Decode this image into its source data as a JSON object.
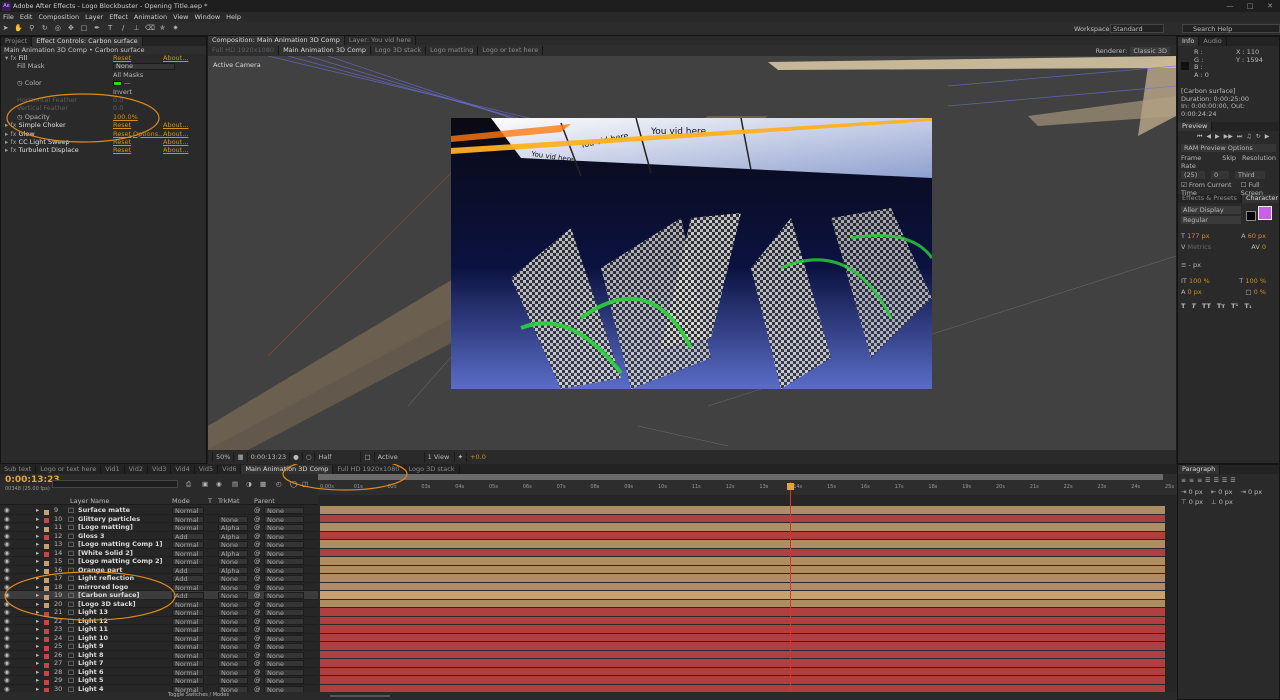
{
  "window": {
    "title": "Adobe After Effects - Logo Blockbuster - Opening Title.aep *",
    "logo": "Ae"
  },
  "menu": [
    "File",
    "Edit",
    "Composition",
    "Layer",
    "Effect",
    "Animation",
    "View",
    "Window",
    "Help"
  ],
  "toolbar": {
    "tools": [
      "selection-icon",
      "hand-icon",
      "zoom-icon",
      "rotate-icon",
      "camera-orbit-icon",
      "pan-behind-icon",
      "rectangle-icon",
      "pen-icon",
      "text-icon",
      "brush-icon",
      "clone-stamp-icon",
      "eraser-icon",
      "roto-brush-icon",
      "puppet-pin-icon"
    ],
    "workspace_label": "Workspace:",
    "workspace_value": "Standard",
    "search_placeholder": "Search Help"
  },
  "left_panel": {
    "tabs": [
      "Project",
      "Effect Controls: Carbon surface"
    ],
    "breadcrumb": "Main Animation 3D Comp • Carbon surface",
    "effects": [
      {
        "name": "Fill",
        "reset": "Reset",
        "about": "About..."
      },
      {
        "name": "Fill Mask",
        "value": "None"
      },
      {
        "name": "",
        "value": "All Masks"
      },
      {
        "name": "Color"
      },
      {
        "name": "",
        "value": "Invert"
      },
      {
        "name": "Horizontal Feather",
        "value": "0.0"
      },
      {
        "name": "Vertical Feather",
        "value": "0.0"
      },
      {
        "name": "Opacity",
        "value": "100.0%"
      },
      {
        "name": "Simple Choker",
        "reset": "Reset",
        "about": "About..."
      },
      {
        "name": "Glow",
        "reset": "Reset",
        "options": "Options...",
        "about": "About..."
      },
      {
        "name": "CC Light Sweep",
        "reset": "Reset",
        "about": "About..."
      },
      {
        "name": "Turbulent Displace",
        "reset": "Reset",
        "about": "About..."
      }
    ]
  },
  "composition": {
    "tabs": [
      "Composition: Main Animation 3D Comp",
      "Layer: You vid here"
    ],
    "subtabs": [
      "Full HD 1920x1080",
      "Main Animation 3D Comp",
      "Logo 3D stack",
      "Logo matting",
      "Logo or text here"
    ],
    "renderer": "Renderer:",
    "renderer_value": "Classic 3D",
    "view_label": "Active Camera",
    "frame_text": "You vid here",
    "viewbar": [
      "50%",
      "0:00:13:23",
      "Half",
      "Active Camera",
      "1 View",
      "+0.0"
    ]
  },
  "info": {
    "tabs": [
      "Info",
      "Audio"
    ],
    "r": "R :",
    "g": "G :",
    "b": "B :",
    "a": "A : 0",
    "x": "X : 110",
    "y": "Y : 1594",
    "layer": "[Carbon surface]",
    "duration": "Duration: 0:00:25:00",
    "inout": "In: 0:00:00:00, Out: 0:00:24:24"
  },
  "preview": {
    "title": "Preview",
    "options": "RAM Preview Options",
    "frame_rate": "Frame Rate",
    "skip": "Skip",
    "resolution": "Resolution",
    "fps": "(25)",
    "skip_val": "0",
    "res_val": "Third",
    "from_current": "From Current Time",
    "full_screen": "Full Screen"
  },
  "character": {
    "tabs": [
      "Effects & Presets",
      "Character"
    ],
    "font": "Aller Display",
    "style": "Regular",
    "size": "177 px",
    "leading": "60 px",
    "kern": "Metrics",
    "track": "0",
    "unit": "- px",
    "vscale": "100 %",
    "hscale": "100 %",
    "baseline": "0 px",
    "tsume": "0 %",
    "fill_color": "#c85fe6"
  },
  "timeline": {
    "tabs": [
      "Sub text",
      "Logo or text here",
      "Vid1",
      "Vid2",
      "Vid3",
      "Vid4",
      "Vid5",
      "Vid6",
      "Main Animation 3D Comp",
      "Full HD 1920x1080",
      "Logo 3D stack"
    ],
    "timecode": "0:00:13:23",
    "frames": "00348 (25.00 fps)",
    "columns": {
      "name": "Layer Name",
      "mode": "Mode",
      "t": "T",
      "trkmat": "TrkMat",
      "parent": "Parent"
    },
    "toggle": "Toggle Switches / Modes",
    "ruler": [
      "0:00s",
      "01s",
      "02s",
      "03s",
      "04s",
      "05s",
      "06s",
      "07s",
      "08s",
      "09s",
      "10s",
      "11s",
      "12s",
      "13s",
      "14s",
      "15s",
      "16s",
      "17s",
      "18s",
      "19s",
      "20s",
      "21s",
      "22s",
      "23s",
      "24s",
      "25s"
    ],
    "layers": [
      {
        "num": "9",
        "name": "Surface matte",
        "mode": "Normal",
        "trk": "",
        "parent": "None",
        "color": "#c6a06e"
      },
      {
        "num": "10",
        "name": "Glittery particles",
        "mode": "Normal",
        "trk": "None",
        "parent": "None",
        "color": "#c94444"
      },
      {
        "num": "11",
        "name": "[Logo matting]",
        "mode": "Normal",
        "trk": "Alpha",
        "parent": "None",
        "color": "#c6a06e"
      },
      {
        "num": "12",
        "name": "Gloss 3",
        "mode": "Add",
        "trk": "Alpha",
        "parent": "None",
        "color": "#c94444"
      },
      {
        "num": "13",
        "name": "[Logo matting Comp 1]",
        "mode": "Normal",
        "trk": "None",
        "parent": "None",
        "color": "#c6a06e"
      },
      {
        "num": "14",
        "name": "[White Solid 2]",
        "mode": "Normal",
        "trk": "Alpha",
        "parent": "None",
        "color": "#c94444"
      },
      {
        "num": "15",
        "name": "[Logo matting Comp 2]",
        "mode": "Normal",
        "trk": "None",
        "parent": "None",
        "color": "#c6a06e"
      },
      {
        "num": "16",
        "name": "Orange part",
        "mode": "Add",
        "trk": "Alpha",
        "parent": "None",
        "color": "#c6a06e"
      },
      {
        "num": "17",
        "name": "Light reflection",
        "mode": "Add",
        "trk": "None",
        "parent": "None",
        "color": "#c6a06e"
      },
      {
        "num": "18",
        "name": "mirrored logo",
        "mode": "Normal",
        "trk": "None",
        "parent": "None",
        "color": "#c6a06e"
      },
      {
        "num": "19",
        "name": "[Carbon surface]",
        "mode": "Add",
        "trk": "None",
        "parent": "None",
        "color": "#c6a06e",
        "selected": true
      },
      {
        "num": "20",
        "name": "[Logo 3D stack]",
        "mode": "Normal",
        "trk": "None",
        "parent": "None",
        "color": "#c6a06e"
      },
      {
        "num": "21",
        "name": "Light 13",
        "mode": "Normal",
        "trk": "None",
        "parent": "None",
        "color": "#c94444"
      },
      {
        "num": "22",
        "name": "Light 12",
        "mode": "Normal",
        "trk": "None",
        "parent": "None",
        "color": "#c94444"
      },
      {
        "num": "23",
        "name": "Light 11",
        "mode": "Normal",
        "trk": "None",
        "parent": "None",
        "color": "#c94444"
      },
      {
        "num": "24",
        "name": "Light 10",
        "mode": "Normal",
        "trk": "None",
        "parent": "None",
        "color": "#c94444"
      },
      {
        "num": "25",
        "name": "Light 9",
        "mode": "Normal",
        "trk": "None",
        "parent": "None",
        "color": "#c94444"
      },
      {
        "num": "26",
        "name": "Light 8",
        "mode": "Normal",
        "trk": "None",
        "parent": "None",
        "color": "#c94444"
      },
      {
        "num": "27",
        "name": "Light 7",
        "mode": "Normal",
        "trk": "None",
        "parent": "None",
        "color": "#c94444"
      },
      {
        "num": "28",
        "name": "Light 6",
        "mode": "Normal",
        "trk": "None",
        "parent": "None",
        "color": "#c94444"
      },
      {
        "num": "29",
        "name": "Light 5",
        "mode": "Normal",
        "trk": "None",
        "parent": "None",
        "color": "#c94444"
      },
      {
        "num": "30",
        "name": "Light 4",
        "mode": "Normal",
        "trk": "None",
        "parent": "None",
        "color": "#c94444"
      }
    ]
  },
  "paragraph": {
    "title": "Paragraph",
    "fields": [
      "0 px",
      "0 px",
      "0 px",
      "0 px",
      "0 px"
    ]
  },
  "accent": "#d88e1a"
}
